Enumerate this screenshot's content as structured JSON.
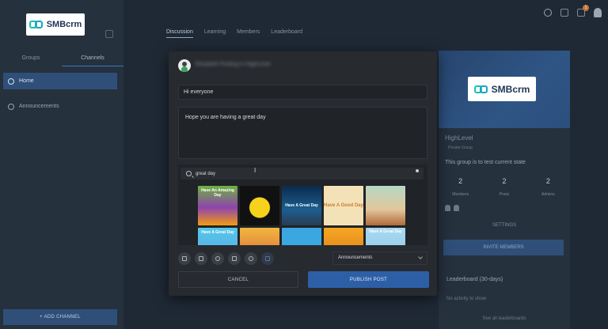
{
  "brand": {
    "name": "SMBcrm"
  },
  "sidebar": {
    "tabs": [
      "Groups",
      "Channels"
    ],
    "active_tab": "Channels",
    "items": [
      {
        "label": "Home",
        "active": true
      },
      {
        "label": "Announcements",
        "active": false
      }
    ],
    "add_channel_label": "+ ADD CHANNEL"
  },
  "topnav": {
    "tabs": [
      "Discussion",
      "Learning",
      "Members",
      "Leaderboard"
    ],
    "active": "Discussion",
    "notification_count": "1"
  },
  "group_panel": {
    "name": "HighLevel",
    "type": "Private Group",
    "description": "This group is to test current state",
    "stats": [
      {
        "value": "2",
        "label": "Members"
      },
      {
        "value": "2",
        "label": "Posts"
      },
      {
        "value": "2",
        "label": "Admins"
      }
    ],
    "settings_label": "SETTINGS",
    "invite_label": "INVITE MEMBERS",
    "leaderboard_title": "Leaderboard (30-days)",
    "leaderboard_empty": "No activity to show",
    "leaderboard_link": "See all leaderboards"
  },
  "post_modal": {
    "author_line": "Elizabeth Posting in HighLevel",
    "title_value": "Hi everyone",
    "body_value": "Hope you are having a great day",
    "gif_search_value": "great day",
    "gifs": [
      {
        "caption": "Have An Amazing Day"
      },
      {
        "caption": ""
      },
      {
        "caption": "Have A Great Day"
      },
      {
        "caption": "Have A Good Day"
      },
      {
        "caption": ""
      },
      {
        "caption": "Have A Great Day"
      },
      {
        "caption": ""
      },
      {
        "caption": ""
      },
      {
        "caption": ""
      },
      {
        "caption": "Have A Great Day"
      }
    ],
    "channel_select": "Announcements",
    "cancel_label": "CANCEL",
    "publish_label": "PUBLISH POST"
  }
}
